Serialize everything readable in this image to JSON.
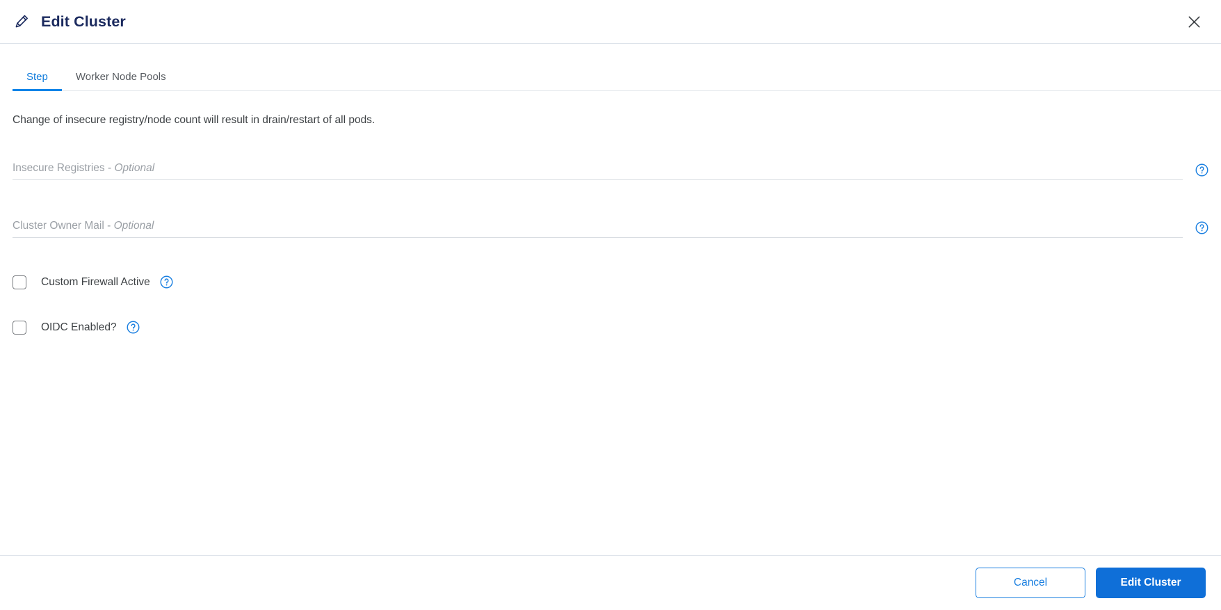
{
  "header": {
    "title": "Edit Cluster",
    "edit_icon": "pencil-icon",
    "close_icon": "close-icon",
    "title_color": "#1b2a5e"
  },
  "tabs": [
    {
      "label": "Step",
      "active": true
    },
    {
      "label": "Worker Node Pools",
      "active": false
    }
  ],
  "body": {
    "description": "Change of insecure registry/node count will result in drain/restart of all pods.",
    "fields": [
      {
        "label_main": "Insecure Registries",
        "label_suffix": " - ",
        "label_optional": "Optional",
        "value": "",
        "placeholder": "",
        "help_icon": "help-circle-icon"
      },
      {
        "label_main": "Cluster Owner Mail",
        "label_suffix": " - ",
        "label_optional": "Optional",
        "value": "",
        "placeholder": "",
        "help_icon": "help-circle-icon"
      }
    ],
    "checkboxes": [
      {
        "label": "Custom Firewall Active",
        "checked": false,
        "help_icon": "help-circle-icon"
      },
      {
        "label": "OIDC Enabled?",
        "checked": false,
        "help_icon": "help-circle-icon"
      }
    ]
  },
  "footer": {
    "cancel_label": "Cancel",
    "submit_label": "Edit Cluster"
  },
  "colors": {
    "accent_blue": "#0f6fd8",
    "tab_active_blue": "#1184e8",
    "help_blue": "#1a7fe0",
    "title_navy": "#1b2a5e",
    "divider": "#dde3ea"
  }
}
